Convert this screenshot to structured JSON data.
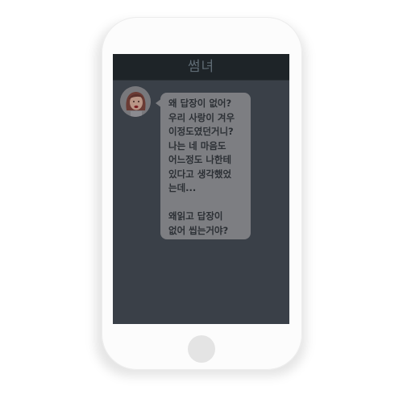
{
  "chat": {
    "title": "썸녀",
    "contact": {
      "avatar_icon": "girl-avatar-icon"
    },
    "messages": [
      {
        "sender": "contact",
        "text": "왜 답장이 없어?\n우리 사랑이 겨우\n이정도였던거니?\n나는 네 마음도\n어느정도 나한테\n있다고 생각했었\n는데...\n\n왜읽고 답장이\n없어 씹는거야?"
      }
    ]
  },
  "device": {
    "home_button_icon": "home-button-icon"
  },
  "colors": {
    "screen_background": "#3a4048",
    "header_background": "#1e2428",
    "bubble_background": "#7d7e82",
    "phone_body": "#fcfcfc"
  }
}
